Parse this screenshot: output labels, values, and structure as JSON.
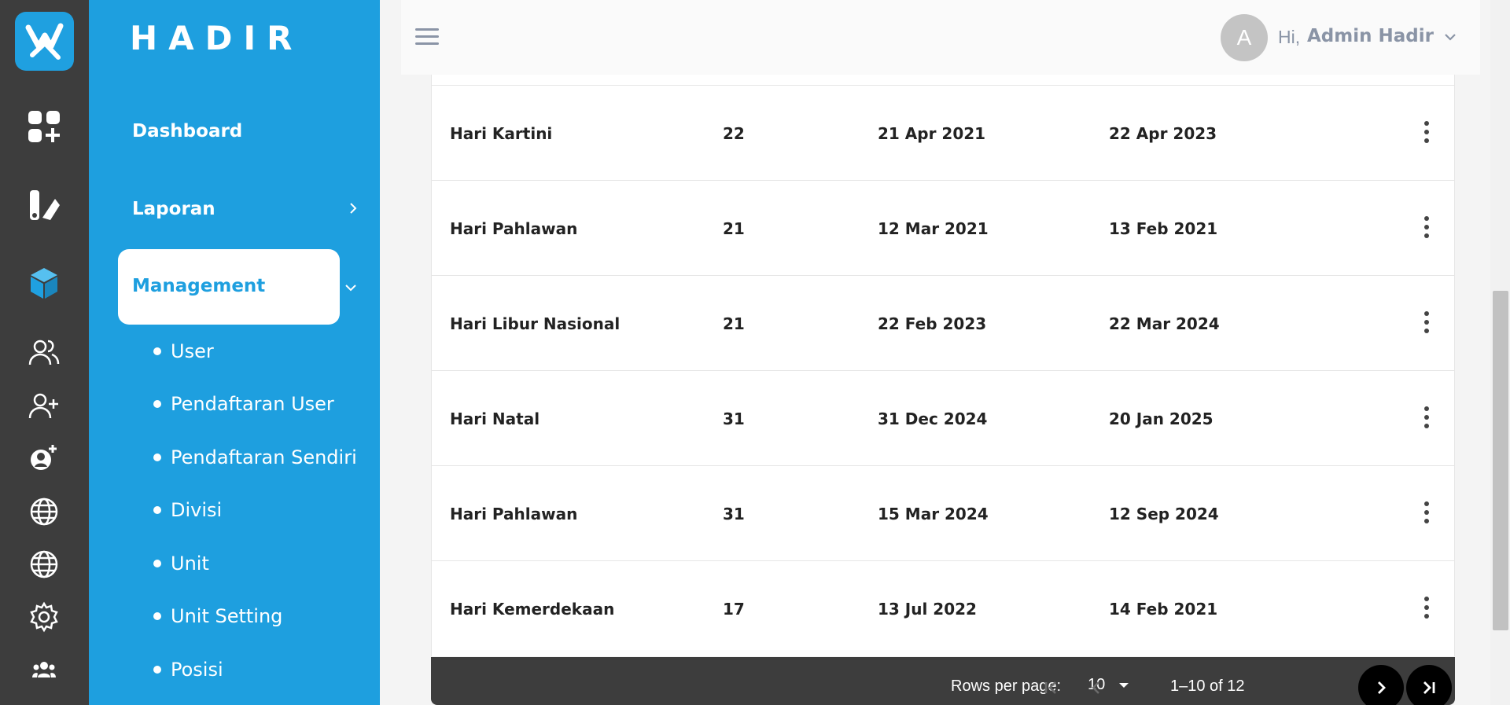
{
  "app": {
    "brand": "HADIR"
  },
  "rail": {
    "icons": [
      "dashboard-plus-icon",
      "reports-icon",
      "cube-icon",
      "users-icon",
      "add-user-icon",
      "user-settings-icon",
      "globe-icon",
      "globe-2-icon",
      "gear-icon",
      "team-icon"
    ],
    "accent": "#1fa0e0"
  },
  "sidebar": {
    "color": "#1e9fdf",
    "items": [
      {
        "label": "Dashboard"
      },
      {
        "label": "Laporan"
      },
      {
        "label": "Management"
      }
    ],
    "subitems": [
      "User",
      "Pendaftaran User",
      "Pendaftaran Sendiri",
      "Divisi",
      "Unit",
      "Unit Setting",
      "Posisi"
    ]
  },
  "header": {
    "avatar_initial": "A",
    "greeting": "Hi,",
    "user_name": "Admin Hadir"
  },
  "table": {
    "rows": [
      {
        "name": "Hari Kartini",
        "count": "22",
        "start": "21 Apr 2021",
        "end": "22 Apr 2023"
      },
      {
        "name": "Hari Pahlawan",
        "count": "21",
        "start": "12 Mar 2021",
        "end": "13 Feb 2021"
      },
      {
        "name": "Hari Libur Nasional",
        "count": "21",
        "start": "22 Feb 2023",
        "end": "22 Mar 2024"
      },
      {
        "name": "Hari Natal",
        "count": "31",
        "start": "31 Dec 2024",
        "end": "20 Jan 2025"
      },
      {
        "name": "Hari Pahlawan",
        "count": "31",
        "start": "15 Mar 2024",
        "end": "12 Sep 2024"
      },
      {
        "name": "Hari Kemerdekaan",
        "count": "17",
        "start": "13 Jul 2022",
        "end": "14 Feb 2021"
      }
    ]
  },
  "pagination": {
    "rows_per_page_label": "Rows per page:",
    "rows_per_page_value": "10",
    "range_text": "1–10 of 12"
  }
}
